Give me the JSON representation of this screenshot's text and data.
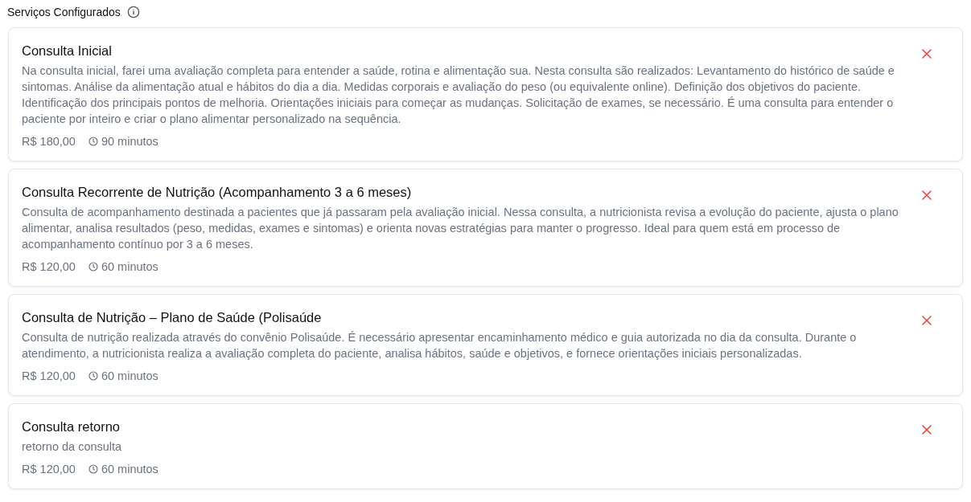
{
  "header": {
    "title": "Serviços Configurados"
  },
  "services": [
    {
      "name": "Consulta Inicial",
      "description": "Na consulta inicial, farei uma avaliação completa para entender a saúde, rotina e alimentação sua. Nesta consulta são realizados: Levantamento do histórico de saúde e sintomas. Análise da alimentação atual e hábitos do dia a dia. Medidas corporais e avaliação do peso (ou equivalente online). Definição dos objetivos do paciente. Identificação dos principais pontos de melhoria. Orientações iniciais para começar as mudanças. Solicitação de exames, se necessário. É uma consulta para entender o paciente por inteiro e criar o plano alimentar personalizado na sequência.",
      "price": "R$ 180,00",
      "duration": "90 minutos"
    },
    {
      "name": "Consulta Recorrente de Nutrição (Acompanhamento 3 a 6 meses)",
      "description": "Consulta de acompanhamento destinada a pacientes que já passaram pela avaliação inicial. Nessa consulta, a nutricionista revisa a evolução do paciente, ajusta o plano alimentar, analisa resultados (peso, medidas, exames e sintomas) e orienta novas estratégias para manter o progresso. Ideal para quem está em processo de acompanhamento contínuo por 3 a 6 meses.",
      "price": "R$ 120,00",
      "duration": "60 minutos"
    },
    {
      "name": "Consulta de Nutrição – Plano de Saúde (Polisaúde",
      "description": "Consulta de nutrição realizada através do convênio Polisaúde. É necessário apresentar encaminhamento médico e guia autorizada no dia da consulta. Durante o atendimento, a nutricionista realiza a avaliação completa do paciente, analisa hábitos, saúde e objetivos, e fornece orientações iniciais personalizadas.",
      "price": "R$ 120,00",
      "duration": "60 minutos"
    },
    {
      "name": "Consulta retorno",
      "description": "retorno da consulta",
      "price": "R$ 120,00",
      "duration": "60 minutos"
    }
  ]
}
